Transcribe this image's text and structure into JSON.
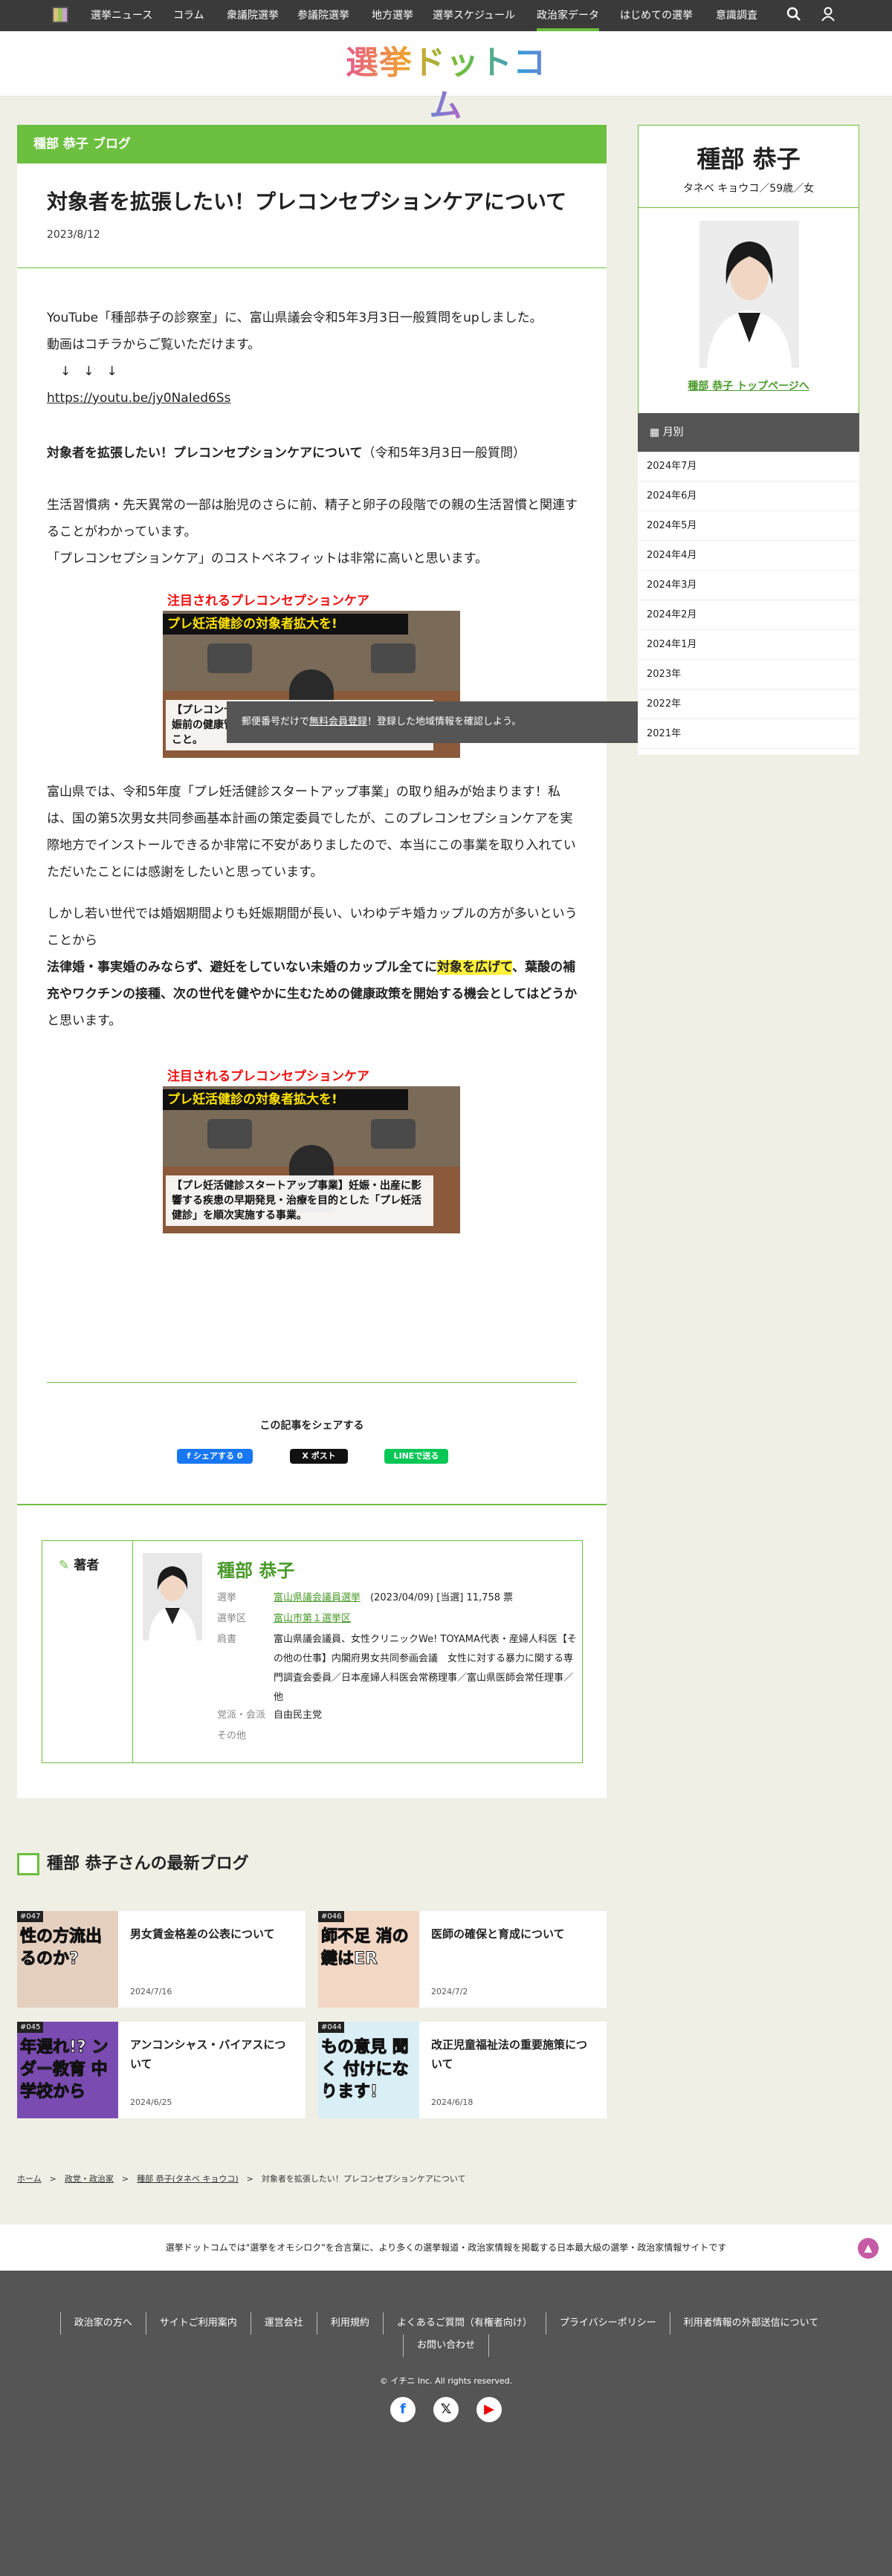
{
  "nav": {
    "items": [
      "選挙ニュース",
      "コラム",
      "衆議院選挙",
      "参議院選挙",
      "地方選挙",
      "選挙スケジュール",
      "政治家データ",
      "はじめての選挙",
      "意識調査"
    ],
    "active_index": 6,
    "search_icon": "search-icon",
    "user_icon": "user-icon"
  },
  "site": {
    "logo_text": "選挙ドットコム"
  },
  "article": {
    "blog_header": "種部 恭子 ブログ",
    "title": "対象者を拡張したい！プレコンセプションケアについて",
    "date": "2023/8/12",
    "p1_line1": "YouTube「種部恭子の診察室」に、富山県議会令和5年3月3日一般質問をupしました。",
    "p1_line2": "動画はコチラからご覧いただけます。",
    "arrows": "↓　↓　↓",
    "link": "https://youtu.be/jy0NaIed6Ss",
    "heading_bold": "対象者を拡張したい！プレコンセプションケアについて",
    "heading_tail": "（令和5年3月3日一般質問）",
    "p2": "生活習慣病・先天異常の一部は胎児のさらに前、精子と卵子の段階での親の生活習慣と関連することがわかっています。",
    "p3": "「プレコンセプションケア」のコストベネフィットは非常に高いと思います。",
    "p4": "富山県では、令和5年度「プレ妊活健診スタートアップ事業」の取り組みが始まります！私は、国の第5次男女共同参画基本計画の策定委員でしたが、このプレコンセプションケアを実際地方でインストールできるか非常に不安がありましたので、本当にこの事業を取り入れていただいたことには感謝をしたいと思っています。",
    "p5_line": "しかし若い世代では婚姻期間よりも妊娠期間が長い、いわゆデキ婚カップルの方が多いということから",
    "p5_bold_a": "法律婚・事実婚のみならず、避妊をしていない未婚のカップル全てに",
    "p5_highlight": "対象を広げて",
    "p5_bold_b": "、葉酸の補充やワクチンの接種、次の世代を健やかに生むための健康政策を開始する機会としてはどうか",
    "p5_tail": "と思います。",
    "fig1": {
      "band1": "注目されるプレコンセプションケア",
      "band2": "プレ妊活健診の対象者拡大を!",
      "caption": "【プレコンセプションケアとは】日本語に訳すと「妊娠前の健康管理」将来の妊娠のための健康管理を行うこと。"
    },
    "fig2": {
      "band1": "注目されるプレコンセプションケア",
      "band2": "プレ妊活健診の対象者拡大を!",
      "caption": "【プレ妊活健診スタートアップ事業】妊娠・出産に影響する疾患の早期発見・治療を目的とした「プレ妊活健診」を順次実施する事業。"
    }
  },
  "toast": {
    "pre": "郵便番号だけで",
    "link": "無料会員登録",
    "post": "！登録した地域情報を確認しよう。",
    "close": "×"
  },
  "share": {
    "title": "この記事をシェアする",
    "facebook": "f シェアする 0",
    "x": "X ポスト",
    "line": "LINEで送る"
  },
  "author": {
    "label": "著者",
    "name": "種部 恭子",
    "election_key": "選挙",
    "election_link": "富山県議会議員選挙",
    "election_info": "(2023/04/09) [当選] 11,758 票",
    "district_key": "選挙区",
    "district_link": "富山市第１選挙区",
    "title_key": "肩書",
    "title_val": "富山県議会議員、女性クリニックWe! TOYAMA代表・産婦人科医【その他の仕事】内閣府男女共同参画会議　女性に対する暴力に関する専門調査会委員／日本産婦人科医会常務理事／富山県医師会常任理事／他",
    "party_key": "党派・会派",
    "party_val": "自由民主党",
    "other_key": "その他"
  },
  "latest": {
    "heading": "種部 恭子さんの最新ブログ",
    "cards": [
      {
        "num": "#047",
        "title": "男女賃金格差の公表について",
        "date": "2024/7/16",
        "thumb_text": "性の方流出るのか?",
        "bg": "#e5d0c0"
      },
      {
        "num": "#046",
        "title": "医師の確保と育成について",
        "date": "2024/7/2",
        "thumb_text": "師不足 消の鍵はER",
        "bg": "#f3d7c5"
      },
      {
        "num": "#045",
        "title": "アンコンシャス・バイアスについて",
        "date": "2024/6/25",
        "thumb_text": "年遅れ!? ンダー教育 中学校から",
        "bg": "#7a4bb0"
      },
      {
        "num": "#044",
        "title": "改正児童福祉法の重要施策について",
        "date": "2024/6/18",
        "thumb_text": "もの意見 聞く 付けになります!",
        "bg": "#d9eef5"
      }
    ]
  },
  "breadcrumb": [
    "ホーム",
    "政党・政治家",
    "種部 恭子(タネベ キョウコ)",
    "対象者を拡張したい！プレコンセプションケアについて"
  ],
  "sidebar": {
    "name": "種部 恭子",
    "kana_info": "タネベ キョウコ／59歳／女",
    "top_link": "種部 恭子 トップページへ",
    "monthly_title": "月別",
    "months": [
      "2024年7月",
      "2024年6月",
      "2024年5月",
      "2024年4月",
      "2024年3月",
      "2024年2月",
      "2024年1月",
      "2023年",
      "2022年",
      "2021年"
    ]
  },
  "footer": {
    "tagline": "選挙ドットコムでは\"選挙をオモシロク\"を合言葉に、より多くの選挙報道・政治家情報を掲載する日本最大級の選挙・政治家情報サイトです",
    "top_icon": "chevron-up-icon",
    "links": [
      "政治家の方へ",
      "サイトご利用案内",
      "運営会社",
      "利用規約",
      "よくあるご質問（有権者向け）",
      "プライバシーポリシー",
      "利用者情報の外部送信について",
      "お問い合わせ"
    ],
    "copyright": "© イチニ Inc. All rights reserved.",
    "social": [
      "facebook-icon",
      "x-icon",
      "youtube-icon"
    ]
  },
  "colors": {
    "accent": "#6cbf3f",
    "nav": "#3a3a3a",
    "highlight": "#fff23b",
    "footer": "#555555"
  }
}
